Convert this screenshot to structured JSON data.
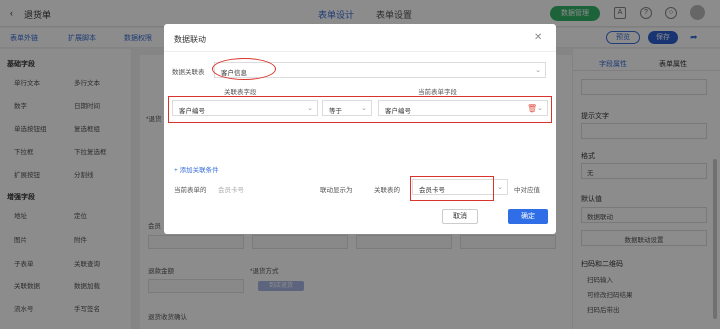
{
  "topbar": {
    "back_icon": "chevron-left-icon",
    "title": "退货单",
    "tabs": [
      "表单设计",
      "表单设置"
    ],
    "manage_button": "数据管理",
    "icons": [
      "text-icon",
      "help-icon",
      "bell-icon",
      "avatar"
    ]
  },
  "subbar": {
    "tools": [
      "表单外链",
      "扩展脚本",
      "数据权限"
    ],
    "preview": "预览",
    "save": "保存",
    "share_icon": "share-icon"
  },
  "left": {
    "basic_title": "基础字段",
    "basic_items": [
      "单行文本",
      "多行文本",
      "数字",
      "日期时间",
      "单选按钮组",
      "复选框组",
      "下拉框",
      "下拉复选框",
      "扩展按钮",
      "分割线"
    ],
    "advanced_title": "增强字段",
    "advanced_items": [
      "地址",
      "定位",
      "图片",
      "附件",
      "子表单",
      "关联查询",
      "关联数据",
      "数据加载",
      "流水号",
      "手写签名"
    ]
  },
  "canvas": {
    "label_return": "*退货",
    "label_member": "会员",
    "refund_amount": "退款金额",
    "refund_method": "*退货方式",
    "pill": "到店退货",
    "confirm": "退货收货确认"
  },
  "right": {
    "tabs": [
      "字段属性",
      "表单属性"
    ],
    "hint": "提示文字",
    "format": "格式",
    "format_value": "无",
    "default": "默认值",
    "default_value": "数据联动",
    "linkage_btn": "数据联动设置",
    "scan": "扫码和二维码",
    "scan_input": "扫码输入",
    "scan_opt2": "可修改扫码结果",
    "scan_opt3": "扫码后带出"
  },
  "dialog": {
    "title": "数据联动",
    "close_icon": "close-icon",
    "linked_table_label": "数据关联表",
    "linked_table_value": "客户信息",
    "col_linked": "关联表字段",
    "col_current": "当前表单字段",
    "row_left": "客户编号",
    "row_op": "等于",
    "row_right": "客户编号",
    "delete_icon": "trash-icon",
    "add_condition": "+ 添加关联条件",
    "current_field_label": "当前表单的",
    "current_field_value": "会员卡号",
    "display_as": "联动显示为",
    "linked_table_of": "关联表的",
    "linked_field_value": "会员卡号",
    "value_suffix": "中对应值",
    "cancel": "取消",
    "ok": "确定"
  }
}
